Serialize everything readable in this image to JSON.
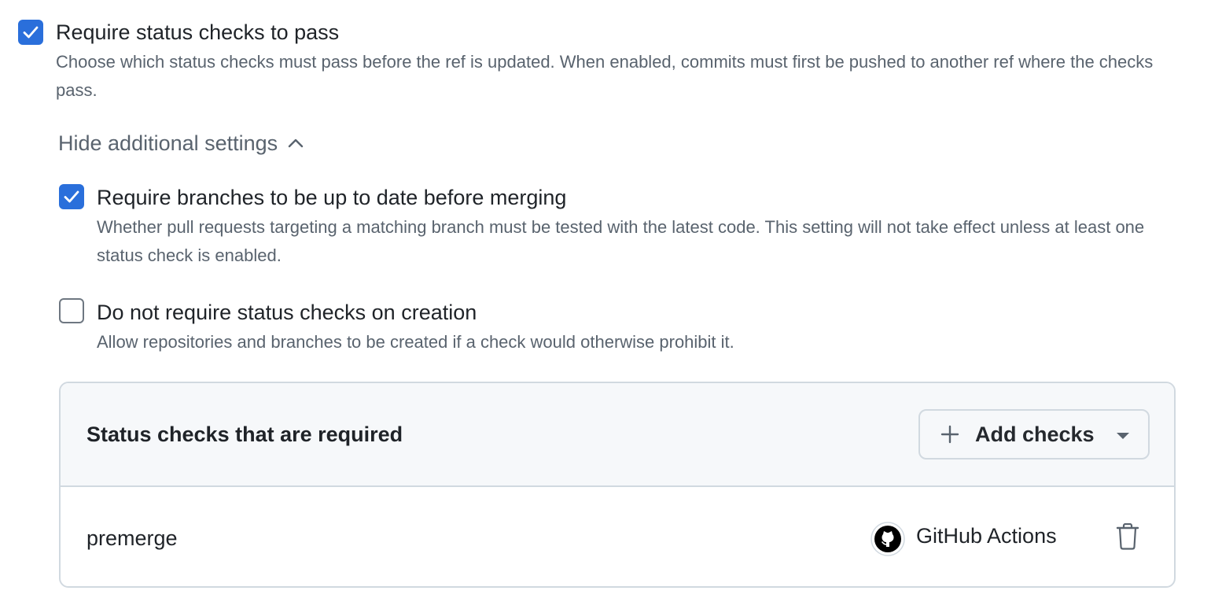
{
  "main_option": {
    "label": "Require status checks to pass",
    "description": "Choose which status checks must pass before the ref is updated. When enabled, commits must first be pushed to another ref where the checks pass.",
    "checked": true
  },
  "toggle": {
    "label": "Hide additional settings"
  },
  "sub_options": [
    {
      "label": "Require branches to be up to date before merging",
      "description": "Whether pull requests targeting a matching branch must be tested with the latest code. This setting will not take effect unless at least one status check is enabled.",
      "checked": true
    },
    {
      "label": "Do not require status checks on creation",
      "description": "Allow repositories and branches to be created if a check would otherwise prohibit it.",
      "checked": false
    }
  ],
  "required_checks": {
    "title": "Status checks that are required",
    "add_button_label": "Add checks",
    "rows": [
      {
        "name": "premerge",
        "app": "GitHub Actions"
      }
    ]
  },
  "colors": {
    "accent": "#2a6fdb",
    "muted_text": "#59636e",
    "border": "#d1d9e0",
    "header_bg": "#f6f8fa"
  },
  "icons": [
    "check-icon",
    "chevron-up-icon",
    "plus-icon",
    "triangle-down-icon",
    "github-actions-icon",
    "trash-icon"
  ]
}
